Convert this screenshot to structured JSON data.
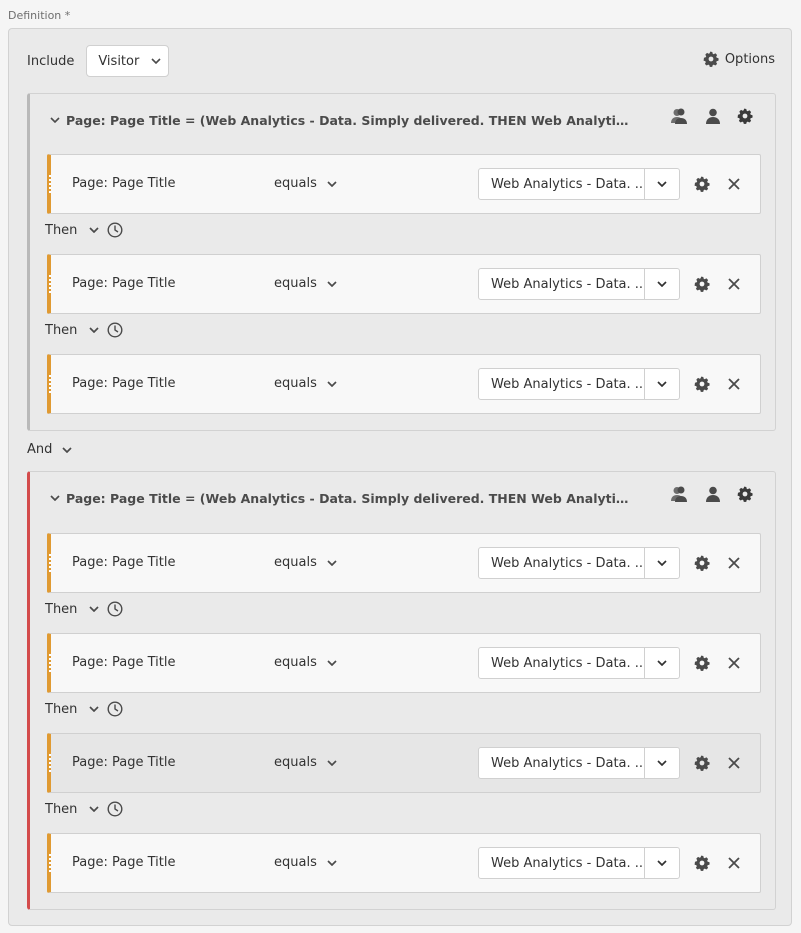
{
  "definition_label": "Definition",
  "required_marker": "*",
  "include": {
    "label": "Include",
    "selected": "Visitor"
  },
  "options_label": "Options",
  "connector_label": "And",
  "containers": [
    {
      "title": "Page: Page Title = (Web Analytics - Data. Simply delivered. THEN Web Analytics - Data. Simply...",
      "rules": [
        {
          "dimension": "Page: Page Title",
          "operator": "equals",
          "value": "Web Analytics - Data. ..."
        },
        {
          "dimension": "Page: Page Title",
          "operator": "equals",
          "value": "Web Analytics - Data. ..."
        },
        {
          "dimension": "Page: Page Title",
          "operator": "equals",
          "value": "Web Analytics - Data. ..."
        }
      ],
      "then_label": "Then"
    },
    {
      "title": "Page: Page Title = (Web Analytics - Data. Simply delivered. THEN Web Analytics - Data. Simply...",
      "rules": [
        {
          "dimension": "Page: Page Title",
          "operator": "equals",
          "value": "Web Analytics - Data. ..."
        },
        {
          "dimension": "Page: Page Title",
          "operator": "equals",
          "value": "Web Analytics - Data. ..."
        },
        {
          "dimension": "Page: Page Title",
          "operator": "equals",
          "value": "Web Analytics - Data. ..."
        },
        {
          "dimension": "Page: Page Title",
          "operator": "equals",
          "value": "Web Analytics - Data. ..."
        }
      ],
      "then_label": "Then"
    }
  ],
  "colors": {
    "rule_accent": "#e09a32",
    "container2_accent": "#d34b4b",
    "container1_accent": "#b9b9b9"
  }
}
